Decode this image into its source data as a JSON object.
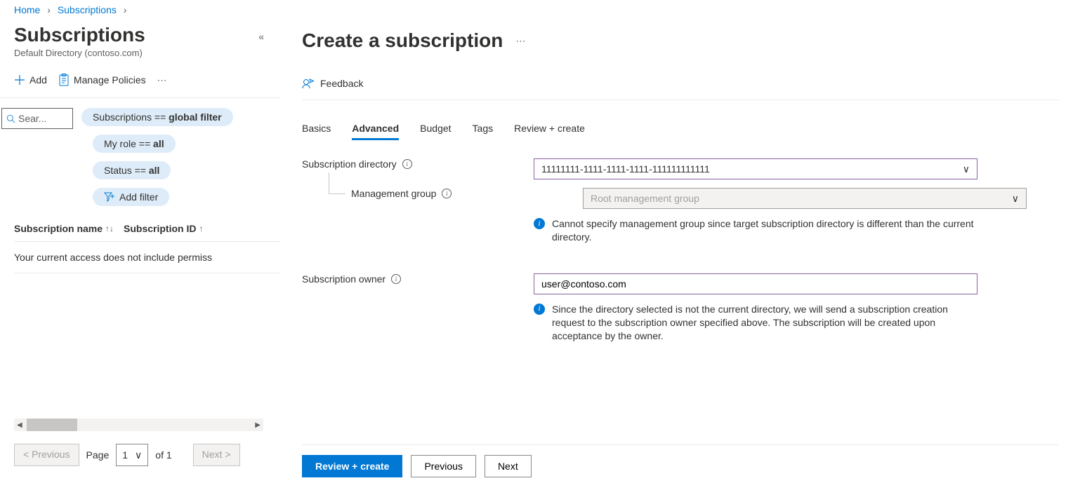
{
  "breadcrumb": [
    "Home",
    "Subscriptions"
  ],
  "left": {
    "title": "Subscriptions",
    "subtitle": "Default Directory (contoso.com)",
    "toolbar": {
      "add": "Add",
      "manage": "Manage Policies"
    },
    "search_placeholder": "Sear...",
    "pills": {
      "subscriptions_prefix": "Subscriptions == ",
      "subscriptions_value": "global filter",
      "role_prefix": "My role == ",
      "role_value": "all",
      "status_prefix": "Status == ",
      "status_value": "all",
      "add_filter": "Add filter"
    },
    "columns": {
      "name": "Subscription name",
      "id": "Subscription ID"
    },
    "empty_row": "Your current access does not include permiss",
    "pager": {
      "prev": "< Previous",
      "page_label": "Page",
      "page_value": "1",
      "of": "of 1",
      "next": "Next >"
    }
  },
  "main": {
    "title": "Create a subscription",
    "feedback": "Feedback",
    "tabs": [
      "Basics",
      "Advanced",
      "Budget",
      "Tags",
      "Review + create"
    ],
    "active_tab": 1,
    "form": {
      "dir_label": "Subscription directory",
      "dir_value": "11111111-1111-1111-1111-111111111111",
      "mg_label": "Management group",
      "mg_placeholder": "Root management group",
      "mg_note": "Cannot specify management group since target subscription directory is different than the current directory.",
      "owner_label": "Subscription owner",
      "owner_value": "user@contoso.com",
      "owner_note": "Since the directory selected is not the current directory, we will send a subscription creation request to the subscription owner specified above. The subscription will be created upon acceptance by the owner."
    },
    "footer": {
      "review": "Review + create",
      "prev": "Previous",
      "next": "Next"
    }
  }
}
